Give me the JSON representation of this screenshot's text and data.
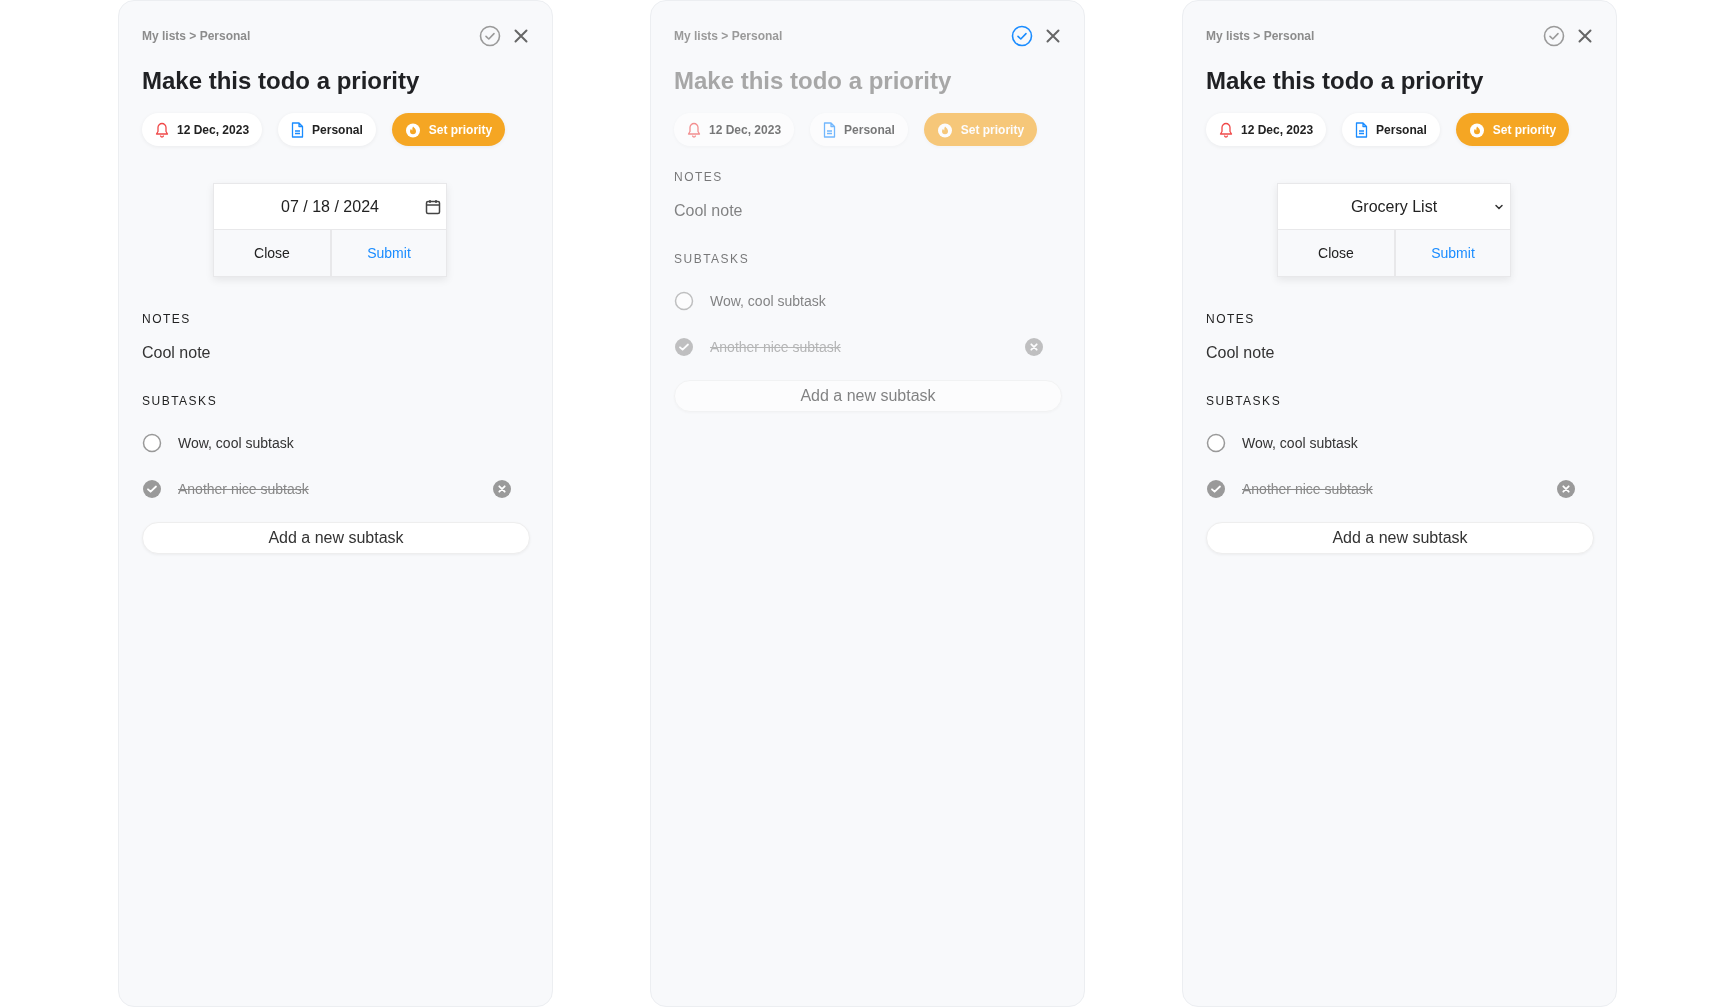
{
  "panels": [
    {
      "breadcrumb": "My lists > Personal",
      "completed": false,
      "title": "Make this todo a priority",
      "chips": [
        {
          "kind": "reminder",
          "label": "12 Dec, 2023"
        },
        {
          "kind": "list",
          "label": "Personal"
        },
        {
          "kind": "priority",
          "label": "Set priority"
        }
      ],
      "popup": {
        "kind": "date",
        "value": "07 / 18 / 2024",
        "buttons": [
          {
            "kind": "close",
            "label": "Close"
          },
          {
            "kind": "submit",
            "label": "Submit"
          }
        ]
      },
      "notes": {
        "heading": "NOTES",
        "text": "Cool note"
      },
      "subtasks": {
        "heading": "SUBTASKS",
        "items": [
          {
            "label": "Wow, cool subtask",
            "checked": false
          },
          {
            "label": "Another nice subtask",
            "checked": true
          }
        ],
        "add_button": "Add a new subtask"
      }
    },
    {
      "breadcrumb": "My lists > Personal",
      "completed": true,
      "title": "Make this todo a priority",
      "chips": [
        {
          "kind": "reminder",
          "label": "12 Dec, 2023"
        },
        {
          "kind": "list",
          "label": "Personal"
        },
        {
          "kind": "priority",
          "label": "Set priority"
        }
      ],
      "notes": {
        "heading": "NOTES",
        "text": "Cool note"
      },
      "subtasks": {
        "heading": "SUBTASKS",
        "items": [
          {
            "label": "Wow, cool subtask",
            "checked": false
          },
          {
            "label": "Another nice subtask",
            "checked": true
          }
        ],
        "add_button": "Add a new subtask"
      }
    },
    {
      "breadcrumb": "My lists > Personal",
      "completed": false,
      "title": "Make this todo a priority",
      "chips": [
        {
          "kind": "reminder",
          "label": "12 Dec, 2023"
        },
        {
          "kind": "list",
          "label": "Personal"
        },
        {
          "kind": "priority",
          "label": "Set priority"
        }
      ],
      "popup": {
        "kind": "select",
        "value": "Grocery List",
        "buttons": [
          {
            "kind": "close",
            "label": "Close"
          },
          {
            "kind": "submit",
            "label": "Submit"
          }
        ]
      },
      "notes": {
        "heading": "NOTES",
        "text": "Cool note"
      },
      "subtasks": {
        "heading": "SUBTASKS",
        "items": [
          {
            "label": "Wow, cool subtask",
            "checked": false
          },
          {
            "label": "Another nice subtask",
            "checked": true
          }
        ],
        "add_button": "Add a new subtask"
      }
    }
  ]
}
